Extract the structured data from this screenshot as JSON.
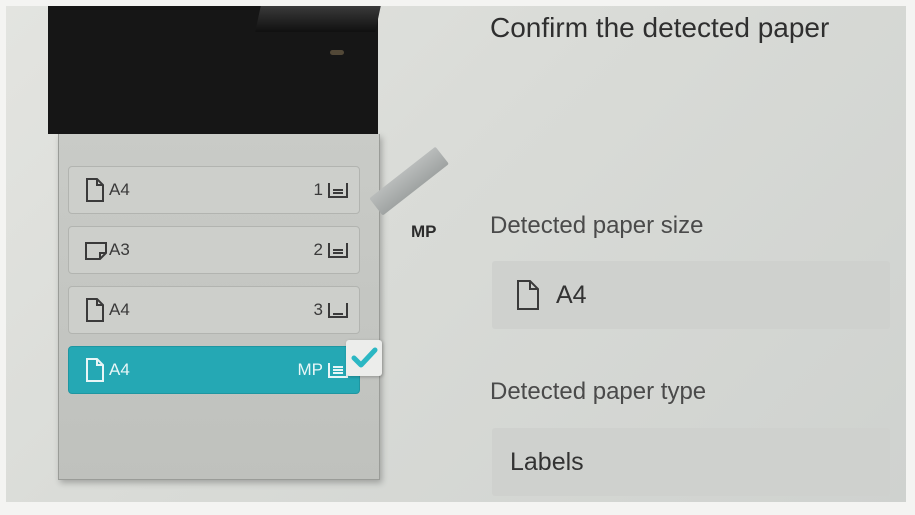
{
  "header": {
    "title": "Confirm the detected paper"
  },
  "printer": {
    "mp_label": "MP"
  },
  "trays": [
    {
      "size": "A4",
      "number": "1",
      "icon": "portrait-doc-icon"
    },
    {
      "size": "A3",
      "number": "2",
      "icon": "landscape-doc-icon"
    },
    {
      "size": "A4",
      "number": "3",
      "icon": "portrait-doc-icon"
    },
    {
      "size": "A4",
      "number": "MP",
      "icon": "portrait-doc-icon",
      "selected": true
    }
  ],
  "detected": {
    "size_label": "Detected paper size",
    "size_value": "A4",
    "type_label": "Detected paper type",
    "type_value": "Labels"
  },
  "colors": {
    "accent": "#25a8b4",
    "check": "#2bb7c3"
  }
}
